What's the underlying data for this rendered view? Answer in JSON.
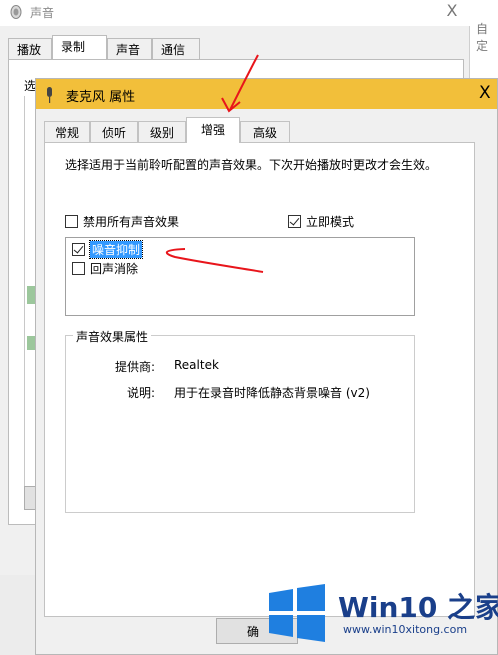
{
  "background_window": {
    "title": "声音",
    "close_glyph": "X",
    "tabs": [
      "播放",
      "录制",
      "声音",
      "通信"
    ],
    "active_tab": 1,
    "select_label": "选",
    "right_edge_text": "自定"
  },
  "dialog": {
    "title": "麦克风 属性",
    "close_glyph": "X",
    "tabs": [
      "常规",
      "侦听",
      "级别",
      "增强",
      "高级"
    ],
    "active_tab": 3,
    "description": "选择适用于当前聆听配置的声音效果。下次开始播放时更改才会生效。",
    "disable_all_label": "禁用所有声音效果",
    "disable_all_checked": false,
    "immediate_mode_label": "立即模式",
    "immediate_mode_checked": true,
    "effects": [
      {
        "label": "噪音抑制",
        "checked": true,
        "selected": true
      },
      {
        "label": "回声消除",
        "checked": false,
        "selected": false
      }
    ],
    "properties_group": {
      "legend": "声音效果属性",
      "provider_label": "提供商:",
      "provider_value": "Realtek",
      "description_label": "说明:",
      "description_value": "用于在录音时降低静态背景噪音 (v2)"
    },
    "ok_button_label": "确"
  },
  "watermark": {
    "brand": "Win10 之家",
    "url": "www.win10xitong.com"
  },
  "colors": {
    "dialog_titlebar": "#f2bf3a",
    "selection": "#3399ff",
    "annotation": "#e8151b",
    "watermark_blue": "#1a3f8a"
  }
}
